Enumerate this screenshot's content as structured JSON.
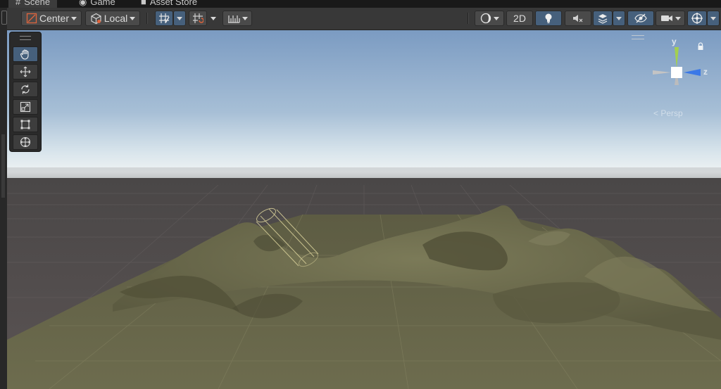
{
  "tabs": [
    {
      "label": "Scene",
      "icon": "grid-icon",
      "active": true
    },
    {
      "label": "Game",
      "icon": "gamepad-icon",
      "active": false
    },
    {
      "label": "Asset Store",
      "icon": "store-bag-icon",
      "active": false
    }
  ],
  "toolbar": {
    "pivot_label": "Center",
    "space_label": "Local",
    "mode_2d_label": "2D"
  },
  "gizmo": {
    "y_label": "y",
    "z_label": "z",
    "projection_label": "Persp"
  },
  "tools": [
    {
      "name": "hand-tool",
      "icon": "hand-icon",
      "active": true
    },
    {
      "name": "move-tool",
      "icon": "move-arrows-icon",
      "active": false
    },
    {
      "name": "rotate-tool",
      "icon": "rotate-icon",
      "active": false
    },
    {
      "name": "scale-tool",
      "icon": "scale-icon",
      "active": false
    },
    {
      "name": "rect-tool",
      "icon": "rect-icon",
      "active": false
    },
    {
      "name": "transform-tool",
      "icon": "transform-icon",
      "active": false
    }
  ],
  "colors": {
    "toolbar_bg": "#383838",
    "button_active": "#46607c",
    "terrain": "#6b6a4c",
    "sky_top": "#7f9ec4",
    "horizon": "#e9eef2",
    "gizmo_y": "#9fd04b",
    "gizmo_z": "#3b78e7"
  }
}
